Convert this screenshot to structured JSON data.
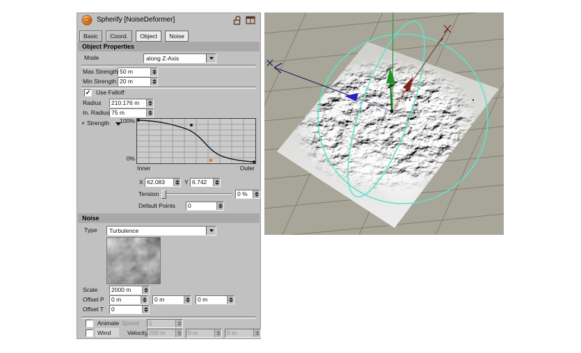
{
  "colors": {
    "panel_bg": "#c1c1c1",
    "section_header_bg": "#a9a9a9",
    "accent_orange": "#e07a20",
    "viewport_bg": "#a7a699",
    "grid_line": "#81806e",
    "plane_gray": "#d9d9d9",
    "gizmo_cyan": "#5ee4c9",
    "axis_green": "#1f9124",
    "axis_red": "#7c241c",
    "axis_navy": "#23235e",
    "axis_blue": "#2424bb"
  },
  "panel": {
    "title": "Spherify [NoiseDeformer]",
    "tabs": [
      {
        "label": "Basic",
        "active": false
      },
      {
        "label": "Coord.",
        "active": false
      },
      {
        "label": "Object",
        "active": true
      },
      {
        "label": "Noise",
        "active": true
      }
    ],
    "object_properties": {
      "header": "Object Properties",
      "mode_label": "Mode",
      "mode_value": "along Z-Axis",
      "max_strength_label": "Max Strength",
      "max_strength_value": "50 m",
      "min_strength_label": "Min Strength",
      "min_strength_value": "20 m",
      "use_falloff_label": "Use Falloff",
      "use_falloff_checked": true,
      "use_falloff_check": "✓",
      "radius_label": "Radius",
      "radius_value": "210.176 m",
      "in_radius_label": "In. Radius",
      "in_radius_value": "75 m",
      "falloff_curve": {
        "axis_prefix": "×",
        "axis_label": "Strength",
        "y_max_label": "100%",
        "y_min_label": "0%",
        "x_min_label": "Inner",
        "x_max_label": "Outer",
        "selected_point": {
          "x": 62.083,
          "y": 6.742
        },
        "points_pct": [
          [
            0,
            100
          ],
          [
            46,
            86
          ],
          [
            62.083,
            6.742
          ],
          [
            100,
            0
          ]
        ]
      },
      "x_label": "X",
      "x_value": "62.083",
      "y_label": "Y",
      "y_value": "6.742",
      "tension_label": "Tension",
      "tension_value": "0 %",
      "default_points_label": "Default Points",
      "default_points_value": "0"
    },
    "noise": {
      "header": "Noise",
      "type_label": "Type",
      "type_value": "Turbulence",
      "scale_label": "Scale",
      "scale_value": "2000 m",
      "offset_p_label": "Offset P",
      "offset_p_values": [
        "0 m",
        "0 m",
        "0 m"
      ],
      "offset_t_label": "Offset T",
      "offset_t_value": "0",
      "animate_label": "Animate",
      "animate_checked": false,
      "animate_check": "",
      "speed_label": "Speed",
      "speed_value": "1",
      "wind_label": "Wind",
      "wind_checked": false,
      "wind_check": "",
      "velocity_label": "Velocity",
      "velocity_values": [
        "200 m",
        "0 m",
        "0 m"
      ]
    }
  },
  "viewport": {
    "axis_end_marker": "×"
  }
}
